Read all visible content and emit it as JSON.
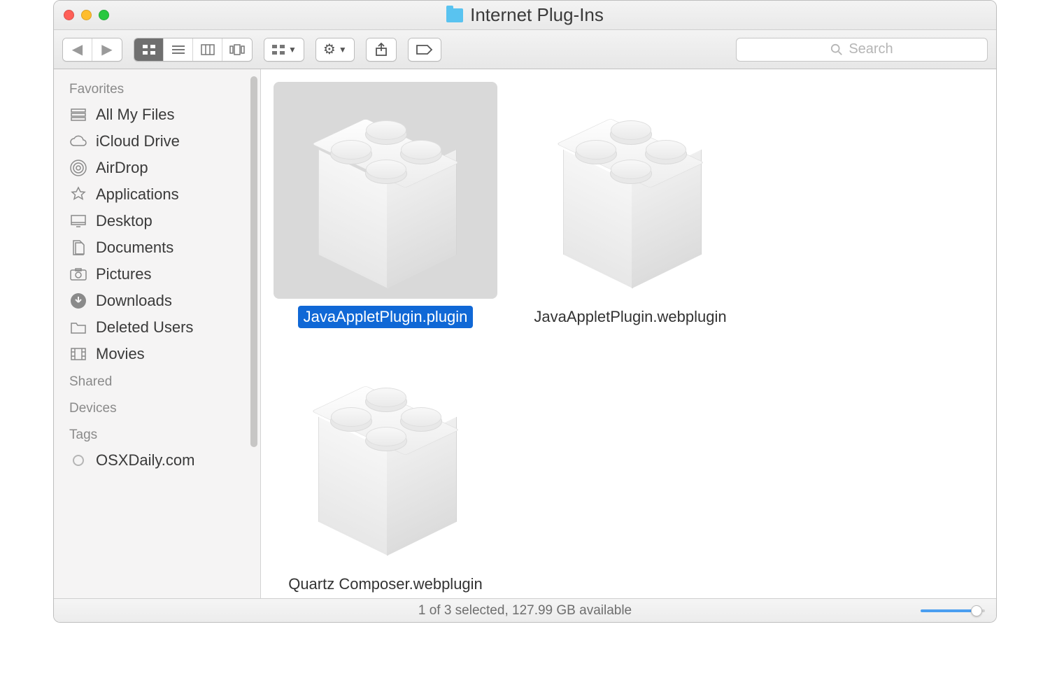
{
  "window": {
    "title": "Internet Plug-Ins"
  },
  "search": {
    "placeholder": "Search"
  },
  "sidebar": {
    "sections": {
      "favorites": "Favorites",
      "shared": "Shared",
      "devices": "Devices",
      "tags": "Tags"
    },
    "favorites": [
      {
        "label": "All My Files",
        "icon": "all-my-files-icon"
      },
      {
        "label": "iCloud Drive",
        "icon": "icloud-icon"
      },
      {
        "label": "AirDrop",
        "icon": "airdrop-icon"
      },
      {
        "label": "Applications",
        "icon": "applications-icon"
      },
      {
        "label": "Desktop",
        "icon": "desktop-icon"
      },
      {
        "label": "Documents",
        "icon": "documents-icon"
      },
      {
        "label": "Pictures",
        "icon": "pictures-icon"
      },
      {
        "label": "Downloads",
        "icon": "downloads-icon"
      },
      {
        "label": "Deleted Users",
        "icon": "folder-icon"
      },
      {
        "label": "Movies",
        "icon": "movies-icon"
      }
    ],
    "tags": [
      {
        "label": "OSXDaily.com"
      }
    ]
  },
  "files": [
    {
      "name": "JavaAppletPlugin.plugin",
      "selected": true
    },
    {
      "name": "JavaAppletPlugin.webplugin",
      "selected": false
    },
    {
      "name": "Quartz Composer.webplugin",
      "selected": false
    }
  ],
  "status": {
    "text": "1 of 3 selected, 127.99 GB available"
  }
}
